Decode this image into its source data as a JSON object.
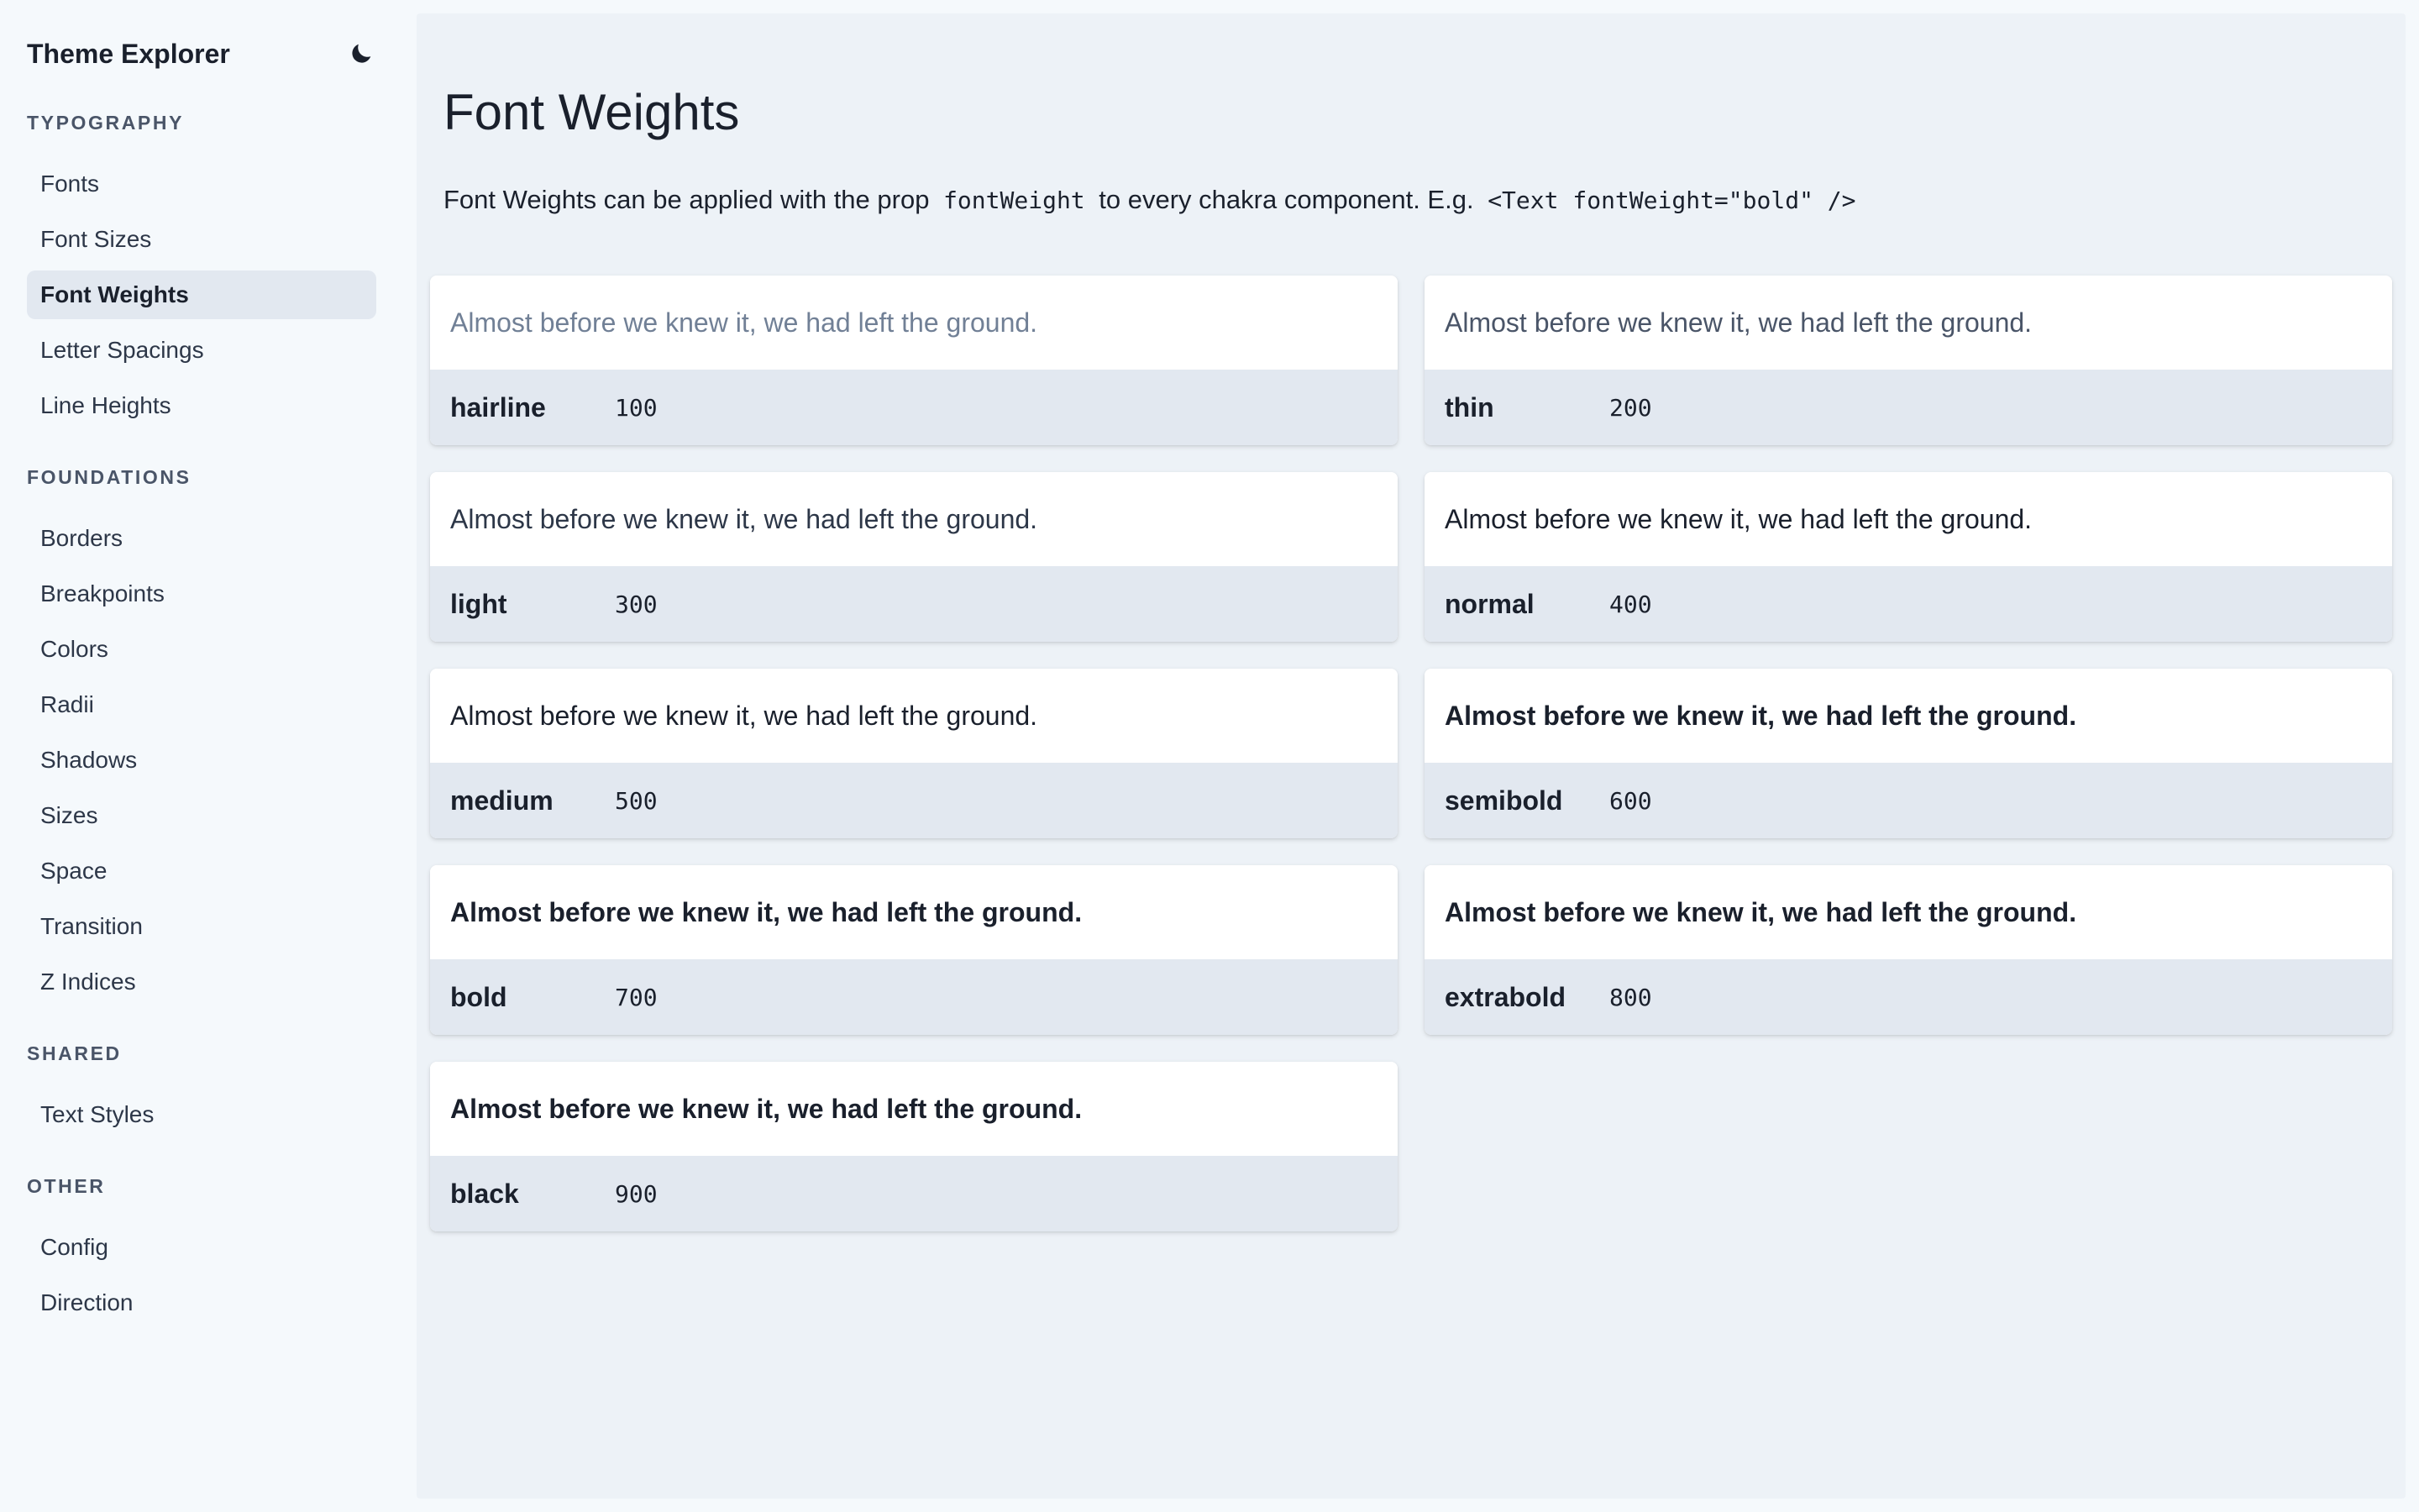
{
  "sidebar": {
    "title": "Theme Explorer",
    "theme_toggle_icon": "moon-icon",
    "groups": [
      {
        "title": "Typography",
        "items": [
          {
            "label": "Fonts",
            "active": false
          },
          {
            "label": "Font Sizes",
            "active": false
          },
          {
            "label": "Font Weights",
            "active": true
          },
          {
            "label": "Letter Spacings",
            "active": false
          },
          {
            "label": "Line Heights",
            "active": false
          }
        ]
      },
      {
        "title": "Foundations",
        "items": [
          {
            "label": "Borders",
            "active": false
          },
          {
            "label": "Breakpoints",
            "active": false
          },
          {
            "label": "Colors",
            "active": false
          },
          {
            "label": "Radii",
            "active": false
          },
          {
            "label": "Shadows",
            "active": false
          },
          {
            "label": "Sizes",
            "active": false
          },
          {
            "label": "Space",
            "active": false
          },
          {
            "label": "Transition",
            "active": false
          },
          {
            "label": "Z Indices",
            "active": false
          }
        ]
      },
      {
        "title": "Shared",
        "items": [
          {
            "label": "Text Styles",
            "active": false
          }
        ]
      },
      {
        "title": "Other",
        "items": [
          {
            "label": "Config",
            "active": false
          },
          {
            "label": "Direction",
            "active": false
          }
        ]
      }
    ]
  },
  "main": {
    "title": "Font Weights",
    "description": {
      "part1": "Font Weights can be applied with the prop",
      "code1": "fontWeight",
      "part2": "to every chakra component. E.g.",
      "code2": "<Text fontWeight=\"bold\" />"
    },
    "sample_text": "Almost before we knew it, we had left the ground.",
    "weights": [
      {
        "name": "hairline",
        "value": "100"
      },
      {
        "name": "thin",
        "value": "200"
      },
      {
        "name": "light",
        "value": "300"
      },
      {
        "name": "normal",
        "value": "400"
      },
      {
        "name": "medium",
        "value": "500"
      },
      {
        "name": "semibold",
        "value": "600"
      },
      {
        "name": "bold",
        "value": "700"
      },
      {
        "name": "extrabold",
        "value": "800"
      },
      {
        "name": "black",
        "value": "900"
      }
    ]
  },
  "colors": {
    "sidebar_bg": "#f5f9fc",
    "main_bg": "#edf2f7",
    "card_meta_bg": "#e2e8f0",
    "active_nav_bg": "#e2e8f0",
    "text": "#1a202c"
  }
}
